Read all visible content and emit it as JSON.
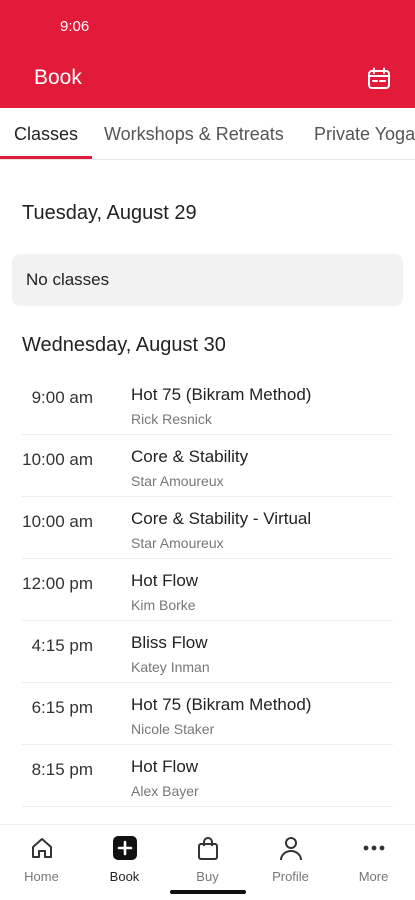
{
  "status_bar": {
    "time": "9:06"
  },
  "header": {
    "title": "Book",
    "calendar_icon": "calendar-icon"
  },
  "tabs": [
    {
      "label": "Classes",
      "active": true
    },
    {
      "label": "Workshops & Retreats",
      "active": false
    },
    {
      "label": "Private Yoga",
      "active": false
    }
  ],
  "days": [
    {
      "heading": "Tuesday, August 29",
      "empty_message": "No classes"
    },
    {
      "heading": "Wednesday, August 30",
      "classes": [
        {
          "time": "9:00 am",
          "name": "Hot 75 (Bikram Method)",
          "instructor": "Rick Resnick"
        },
        {
          "time": "10:00 am",
          "name": "Core & Stability",
          "instructor": "Star Amoureux"
        },
        {
          "time": "10:00 am",
          "name": "Core & Stability - Virtual",
          "instructor": "Star Amoureux"
        },
        {
          "time": "12:00 pm",
          "name": "Hot Flow",
          "instructor": "Kim Borke"
        },
        {
          "time": "4:15 pm",
          "name": "Bliss Flow",
          "instructor": "Katey Inman"
        },
        {
          "time": "6:15 pm",
          "name": "Hot 75 (Bikram Method)",
          "instructor": "Nicole Staker"
        },
        {
          "time": "8:15 pm",
          "name": "Hot Flow",
          "instructor": "Alex Bayer"
        }
      ]
    }
  ],
  "bottom_nav": [
    {
      "label": "Home",
      "icon": "home-icon"
    },
    {
      "label": "Book",
      "icon": "plus-square-icon",
      "active": true
    },
    {
      "label": "Buy",
      "icon": "shopping-bag-icon"
    },
    {
      "label": "Profile",
      "icon": "person-icon"
    },
    {
      "label": "More",
      "icon": "more-dots-icon"
    }
  ],
  "colors": {
    "brand": "#e31b3a",
    "active_tab_indicator": "#e31b3a"
  }
}
